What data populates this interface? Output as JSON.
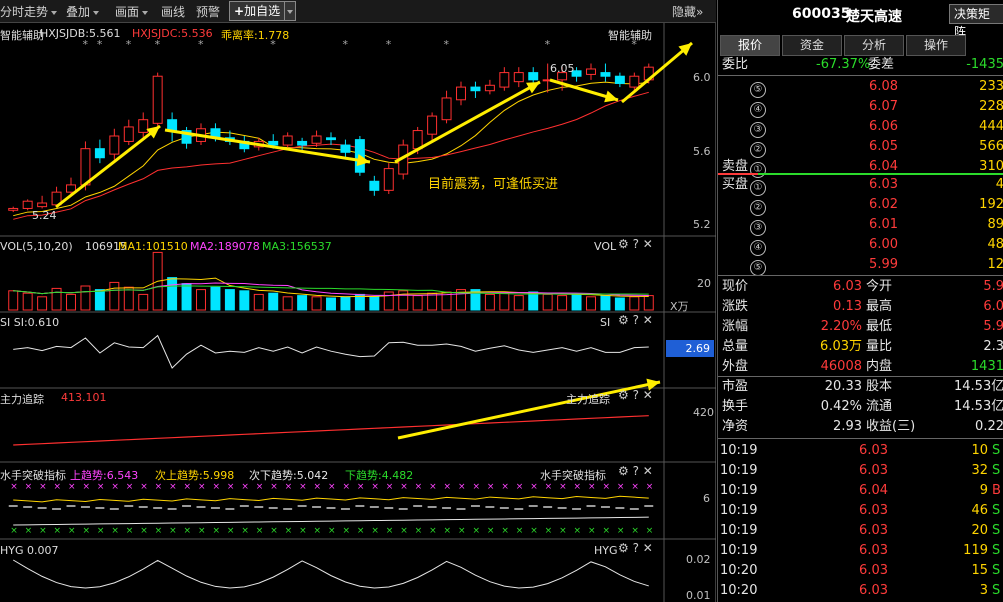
{
  "toolbar": {
    "items": [
      "分时走势",
      "叠加",
      "画面",
      "画线",
      "预警"
    ],
    "add_fav": "加自选",
    "hide": "隐藏"
  },
  "main_panel": {
    "title": "智能辅助",
    "title_right": "智能辅助",
    "ind1_label": "HXJSJDB:5.561",
    "ind2_label": "HXJSJDC:5.536",
    "ratio_label": "乖离率:1.778",
    "low_label": "5.24",
    "high_label": "6.05",
    "annotation": "目前震荡，可逢低买进",
    "y_ticks": [
      "6.0",
      "5.6",
      "5.2"
    ]
  },
  "vol_panel": {
    "label": "VOL(5,10,20)",
    "value": "106915",
    "ma1": "MA1:101510",
    "ma2": "MA2:189078",
    "ma3": "MA3:156537",
    "name": "VOL",
    "y_tick": "20",
    "unit": "X万"
  },
  "si_panel": {
    "label": "SI SI:0.610",
    "name": "SI",
    "current": "2.69"
  },
  "zl_panel": {
    "label": "主力追踪",
    "value": "413.101",
    "name": "主力追踪",
    "y_tick": "420"
  },
  "ss_panel": {
    "label": "水手突破指标",
    "up": "上趋势:6.543",
    "sub_up": "次上趋势:5.998",
    "sub_down": "次下趋势:5.042",
    "down": "下趋势:4.482",
    "name": "水手突破指标",
    "y_tick": "6"
  },
  "hyg_panel": {
    "label": "HYG 0.007",
    "name": "HYG",
    "y_tick1": "0.02",
    "y_tick2": "0.01"
  },
  "stock": {
    "code": "600035",
    "name": "楚天高速",
    "button": "决策矩阵"
  },
  "tabs": [
    "报价",
    "资金",
    "分析",
    "操作"
  ],
  "order": {
    "webi_label": "委比",
    "webi_value": "-67.37%",
    "wecha_label": "委差",
    "wecha_value": "-1435",
    "sell_label": "卖盘",
    "buy_label": "买盘",
    "sells": [
      {
        "n": "⑤",
        "price": "6.08",
        "vol": "233"
      },
      {
        "n": "④",
        "price": "6.07",
        "vol": "228"
      },
      {
        "n": "③",
        "price": "6.06",
        "vol": "444"
      },
      {
        "n": "②",
        "price": "6.05",
        "vol": "566"
      },
      {
        "n": "①",
        "price": "6.04",
        "vol": "310"
      }
    ],
    "buys": [
      {
        "n": "①",
        "price": "6.03",
        "vol": "4"
      },
      {
        "n": "②",
        "price": "6.02",
        "vol": "192"
      },
      {
        "n": "③",
        "price": "6.01",
        "vol": "89"
      },
      {
        "n": "④",
        "price": "6.00",
        "vol": "48"
      },
      {
        "n": "⑤",
        "price": "5.99",
        "vol": "12"
      }
    ]
  },
  "quote": [
    {
      "l1": "现价",
      "v1": "6.03",
      "c1": "red",
      "l2": "今开",
      "v2": "5.9",
      "c2": "red"
    },
    {
      "l1": "涨跌",
      "v1": "0.13",
      "c1": "red",
      "l2": "最高",
      "v2": "6.0",
      "c2": "red"
    },
    {
      "l1": "涨幅",
      "v1": "2.20%",
      "c1": "red",
      "l2": "最低",
      "v2": "5.9",
      "c2": "red"
    },
    {
      "l1": "总量",
      "v1": "6.03万",
      "c1": "yellow",
      "l2": "量比",
      "v2": "2.3",
      "c2": "white"
    },
    {
      "l1": "外盘",
      "v1": "46008",
      "c1": "red",
      "l2": "内盘",
      "v2": "1431",
      "c2": "green"
    }
  ],
  "fund": [
    {
      "l1": "市盈",
      "v1": "20.33",
      "l2": "股本",
      "v2": "14.53亿"
    },
    {
      "l1": "换手",
      "v1": "0.42%",
      "l2": "流通",
      "v2": "14.53亿"
    },
    {
      "l1": "净资",
      "v1": "2.93",
      "l2": "收益(三)",
      "v2": "0.22"
    }
  ],
  "ticks": [
    {
      "t": "10:19",
      "p": "6.03",
      "v": "10",
      "s": "S"
    },
    {
      "t": "10:19",
      "p": "6.03",
      "v": "32",
      "s": "S"
    },
    {
      "t": "10:19",
      "p": "6.04",
      "v": "9",
      "s": "B"
    },
    {
      "t": "10:19",
      "p": "6.03",
      "v": "46",
      "s": "S"
    },
    {
      "t": "10:19",
      "p": "6.03",
      "v": "20",
      "s": "S"
    },
    {
      "t": "10:19",
      "p": "6.03",
      "v": "119",
      "s": "S"
    },
    {
      "t": "10:20",
      "p": "6.03",
      "v": "15",
      "s": "S"
    },
    {
      "t": "10:20",
      "p": "6.03",
      "v": "3",
      "s": "S"
    }
  ],
  "chart_data": {
    "type": "candlestick",
    "ylim": [
      5.12,
      6.18
    ],
    "candles": [
      {
        "o": 5.24,
        "c": 5.25,
        "h": 5.26,
        "l": 5.23,
        "v": 16
      },
      {
        "o": 5.25,
        "c": 5.29,
        "h": 5.3,
        "l": 5.24,
        "v": 14
      },
      {
        "o": 5.26,
        "c": 5.28,
        "h": 5.32,
        "l": 5.25,
        "v": 11
      },
      {
        "o": 5.27,
        "c": 5.34,
        "h": 5.37,
        "l": 5.26,
        "v": 18
      },
      {
        "o": 5.34,
        "c": 5.38,
        "h": 5.42,
        "l": 5.32,
        "v": 13
      },
      {
        "o": 5.38,
        "c": 5.58,
        "h": 5.62,
        "l": 5.35,
        "v": 20
      },
      {
        "o": 5.58,
        "c": 5.53,
        "h": 5.63,
        "l": 5.5,
        "v": 17
      },
      {
        "o": 5.55,
        "c": 5.65,
        "h": 5.69,
        "l": 5.52,
        "v": 23
      },
      {
        "o": 5.62,
        "c": 5.7,
        "h": 5.74,
        "l": 5.6,
        "v": 19
      },
      {
        "o": 5.67,
        "c": 5.74,
        "h": 5.78,
        "l": 5.64,
        "v": 13
      },
      {
        "o": 5.72,
        "c": 5.98,
        "h": 6.0,
        "l": 5.7,
        "v": 48
      },
      {
        "o": 5.74,
        "c": 5.68,
        "h": 5.78,
        "l": 5.62,
        "v": 27
      },
      {
        "o": 5.68,
        "c": 5.61,
        "h": 5.7,
        "l": 5.58,
        "v": 22
      },
      {
        "o": 5.62,
        "c": 5.69,
        "h": 5.72,
        "l": 5.6,
        "v": 17
      },
      {
        "o": 5.69,
        "c": 5.64,
        "h": 5.72,
        "l": 5.62,
        "v": 19
      },
      {
        "o": 5.64,
        "c": 5.62,
        "h": 5.68,
        "l": 5.6,
        "v": 17
      },
      {
        "o": 5.62,
        "c": 5.58,
        "h": 5.65,
        "l": 5.56,
        "v": 16
      },
      {
        "o": 5.59,
        "c": 5.62,
        "h": 5.64,
        "l": 5.57,
        "v": 13
      },
      {
        "o": 5.62,
        "c": 5.6,
        "h": 5.66,
        "l": 5.58,
        "v": 14
      },
      {
        "o": 5.6,
        "c": 5.65,
        "h": 5.67,
        "l": 5.58,
        "v": 11
      },
      {
        "o": 5.62,
        "c": 5.6,
        "h": 5.64,
        "l": 5.57,
        "v": 12
      },
      {
        "o": 5.61,
        "c": 5.65,
        "h": 5.68,
        "l": 5.59,
        "v": 11
      },
      {
        "o": 5.64,
        "c": 5.63,
        "h": 5.67,
        "l": 5.6,
        "v": 10
      },
      {
        "o": 5.6,
        "c": 5.56,
        "h": 5.63,
        "l": 5.52,
        "v": 11
      },
      {
        "o": 5.63,
        "c": 5.45,
        "h": 5.65,
        "l": 5.43,
        "v": 13
      },
      {
        "o": 5.4,
        "c": 5.35,
        "h": 5.43,
        "l": 5.32,
        "v": 11
      },
      {
        "o": 5.35,
        "c": 5.47,
        "h": 5.5,
        "l": 5.33,
        "v": 15
      },
      {
        "o": 5.44,
        "c": 5.6,
        "h": 5.63,
        "l": 5.41,
        "v": 16
      },
      {
        "o": 5.58,
        "c": 5.68,
        "h": 5.7,
        "l": 5.55,
        "v": 12
      },
      {
        "o": 5.66,
        "c": 5.76,
        "h": 5.78,
        "l": 5.62,
        "v": 14
      },
      {
        "o": 5.74,
        "c": 5.86,
        "h": 5.9,
        "l": 5.72,
        "v": 15
      },
      {
        "o": 5.85,
        "c": 5.92,
        "h": 5.95,
        "l": 5.82,
        "v": 17
      },
      {
        "o": 5.92,
        "c": 5.9,
        "h": 5.95,
        "l": 5.86,
        "v": 17
      },
      {
        "o": 5.9,
        "c": 5.93,
        "h": 5.96,
        "l": 5.88,
        "v": 13
      },
      {
        "o": 5.92,
        "c": 6.0,
        "h": 6.03,
        "l": 5.9,
        "v": 14
      },
      {
        "o": 5.95,
        "c": 6.0,
        "h": 6.03,
        "l": 5.92,
        "v": 12
      },
      {
        "o": 6.0,
        "c": 5.96,
        "h": 6.03,
        "l": 5.9,
        "v": 15
      },
      {
        "o": 5.96,
        "c": 5.96,
        "h": 6.05,
        "l": 5.89,
        "v": 13
      },
      {
        "o": 5.96,
        "c": 6.0,
        "h": 6.03,
        "l": 5.9,
        "v": 12
      },
      {
        "o": 6.01,
        "c": 5.98,
        "h": 6.03,
        "l": 5.95,
        "v": 13
      },
      {
        "o": 5.99,
        "c": 6.02,
        "h": 6.05,
        "l": 5.96,
        "v": 11
      },
      {
        "o": 6.0,
        "c": 5.98,
        "h": 6.05,
        "l": 5.95,
        "v": 12
      },
      {
        "o": 5.98,
        "c": 5.94,
        "h": 6.0,
        "l": 5.92,
        "v": 10
      },
      {
        "o": 5.92,
        "c": 5.98,
        "h": 6.0,
        "l": 5.9,
        "v": 11
      },
      {
        "o": 5.96,
        "c": 6.03,
        "h": 6.05,
        "l": 5.94,
        "v": 12
      }
    ]
  }
}
